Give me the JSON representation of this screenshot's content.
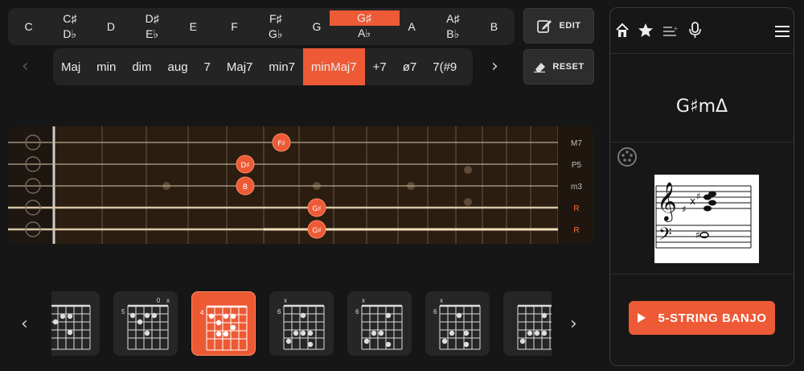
{
  "notes": [
    {
      "top": "C",
      "bottom": ""
    },
    {
      "top": "C♯",
      "bottom": "D♭"
    },
    {
      "top": "D",
      "bottom": ""
    },
    {
      "top": "D♯",
      "bottom": "E♭"
    },
    {
      "top": "E",
      "bottom": ""
    },
    {
      "top": "F",
      "bottom": ""
    },
    {
      "top": "F♯",
      "bottom": "G♭"
    },
    {
      "top": "G",
      "bottom": ""
    },
    {
      "top": "G♯",
      "bottom": "A♭"
    },
    {
      "top": "A",
      "bottom": ""
    },
    {
      "top": "A♯",
      "bottom": "B♭"
    },
    {
      "top": "B",
      "bottom": ""
    }
  ],
  "selected_note_index": 8,
  "buttons": {
    "edit": "EDIT",
    "reset": "RESET"
  },
  "types": [
    "Maj",
    "min",
    "dim",
    "aug",
    "7",
    "Maj7",
    "min7",
    "minMaj7",
    "+7",
    "ø7",
    "7(#9"
  ],
  "selected_type_index": 7,
  "fretboard": {
    "interval_labels": [
      {
        "text": "M7",
        "color": "#bfbfbf"
      },
      {
        "text": "P5",
        "color": "#bfbfbf"
      },
      {
        "text": "m3",
        "color": "#bfbfbf"
      },
      {
        "text": "R",
        "color": "#ff6a3a"
      },
      {
        "text": "R",
        "color": "#ff6a3a"
      }
    ],
    "notes": [
      {
        "label": "F♯",
        "string": 0,
        "fret": 5
      },
      {
        "label": "D♯",
        "string": 1,
        "fret": 4
      },
      {
        "label": "B",
        "string": 2,
        "fret": 4
      },
      {
        "label": "G♯",
        "string": 3,
        "fret": 6
      },
      {
        "label": "G♯",
        "string": 4,
        "fret": 6
      }
    ]
  },
  "chord_cards": [
    {
      "fret": "",
      "marks": []
    },
    {
      "fret": "5",
      "marks": [
        "0",
        "x"
      ]
    },
    {
      "fret": "4",
      "marks": []
    },
    {
      "fret": "6",
      "marks": [
        "x"
      ]
    },
    {
      "fret": "6",
      "marks": [
        "x"
      ]
    },
    {
      "fret": "6",
      "marks": [
        "x"
      ]
    },
    {
      "fret": "",
      "marks": []
    }
  ],
  "selected_card_index": 2,
  "panel": {
    "chord_symbol": "G♯mΔ",
    "play_label": "5-STRING BANJO",
    "icons": [
      "home-icon",
      "star-icon",
      "playlist-icon",
      "microphone-icon",
      "menu-icon"
    ]
  },
  "colors": {
    "accent": "#ed5a35",
    "fretboard": "#2b1d10"
  }
}
